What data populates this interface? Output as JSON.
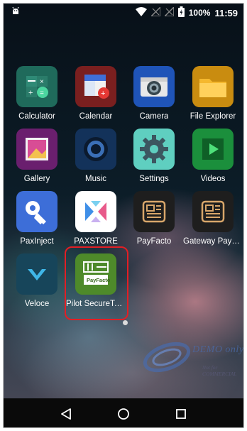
{
  "status_bar": {
    "battery": "100%",
    "time": "11:59"
  },
  "apps": [
    {
      "label": "Calculator",
      "icon": "calculator-icon"
    },
    {
      "label": "Calendar",
      "icon": "calendar-icon"
    },
    {
      "label": "Camera",
      "icon": "camera-icon"
    },
    {
      "label": "File Explorer",
      "icon": "folder-icon"
    },
    {
      "label": "Gallery",
      "icon": "gallery-icon"
    },
    {
      "label": "Music",
      "icon": "speaker-icon"
    },
    {
      "label": "Settings",
      "icon": "gear-icon"
    },
    {
      "label": "Videos",
      "icon": "play-icon"
    },
    {
      "label": "PaxInject",
      "icon": "key-icon"
    },
    {
      "label": "PAXSTORE",
      "icon": "paxstore-icon"
    },
    {
      "label": "PayFacto",
      "icon": "payfacto-terminal-icon"
    },
    {
      "label": "Gateway PayF…",
      "icon": "payfacto-terminal-icon"
    },
    {
      "label": "Veloce",
      "icon": "veloce-icon"
    },
    {
      "label": "Pilot SecureTa…",
      "icon": "payfacto-card-icon"
    }
  ],
  "pilot_icon_text": "PayFacto",
  "watermark": {
    "line1": "DEMO only",
    "line2": "Not for COMMERCIAL"
  },
  "colors": {
    "highlight": "#e31e24",
    "label": "#ffffff"
  }
}
